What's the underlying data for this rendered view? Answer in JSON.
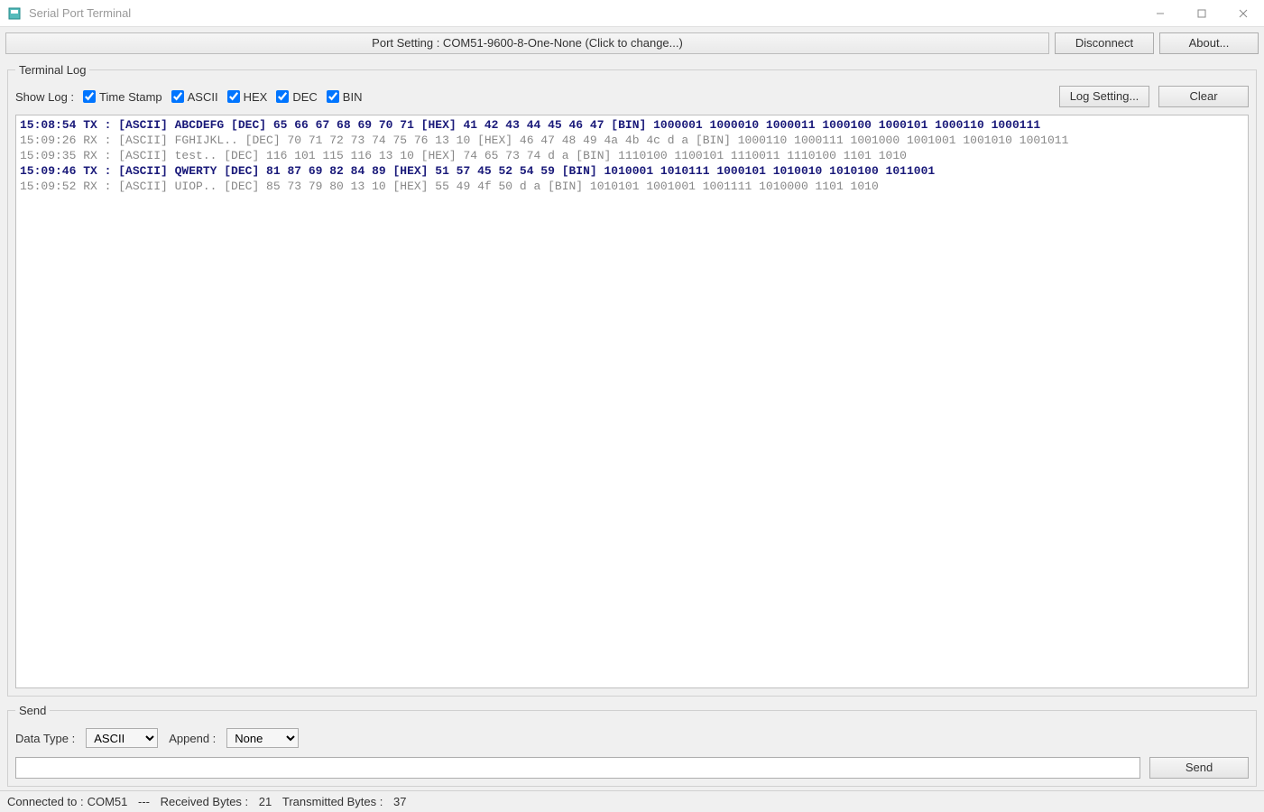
{
  "window": {
    "title": "Serial Port Terminal"
  },
  "toolbar": {
    "port_setting_label": "Port Setting : COM51-9600-8-One-None (Click to change...)",
    "disconnect_label": "Disconnect",
    "about_label": "About..."
  },
  "log_panel": {
    "legend": "Terminal Log",
    "show_log_label": "Show Log :",
    "checkboxes": {
      "timestamp": "Time Stamp",
      "ascii": "ASCII",
      "hex": "HEX",
      "dec": "DEC",
      "bin": "BIN"
    },
    "log_setting_label": "Log Setting...",
    "clear_label": "Clear",
    "lines": [
      {
        "cls": "tx",
        "text": "15:08:54 TX : [ASCII] ABCDEFG [DEC] 65 66 67 68 69 70 71 [HEX] 41 42 43 44 45 46 47 [BIN] 1000001 1000010 1000011 1000100 1000101 1000110 1000111"
      },
      {
        "cls": "rx",
        "text": "15:09:26 RX : [ASCII] FGHIJKL.. [DEC] 70 71 72 73 74 75 76 13 10 [HEX] 46 47 48 49 4a 4b 4c d a [BIN] 1000110 1000111 1001000 1001001 1001010 1001011"
      },
      {
        "cls": "rx",
        "text": "15:09:35 RX : [ASCII] test.. [DEC] 116 101 115 116 13 10 [HEX] 74 65 73 74 d a [BIN] 1110100 1100101 1110011 1110100 1101 1010"
      },
      {
        "cls": "tx",
        "text": "15:09:46 TX : [ASCII] QWERTY [DEC] 81 87 69 82 84 89 [HEX] 51 57 45 52 54 59 [BIN] 1010001 1010111 1000101 1010010 1010100 1011001"
      },
      {
        "cls": "rx",
        "text": "15:09:52 RX : [ASCII] UIOP.. [DEC] 85 73 79 80 13 10 [HEX] 55 49 4f 50 d a [BIN] 1010101 1001001 1001111 1010000 1101 1010"
      }
    ]
  },
  "send_panel": {
    "legend": "Send",
    "data_type_label": "Data Type :",
    "data_type_value": "ASCII",
    "append_label": "Append :",
    "append_value": "None",
    "send_button": "Send",
    "input_value": ""
  },
  "statusbar": {
    "connected_label": "Connected to :",
    "port": "COM51",
    "sep": "---",
    "rx_label": "Received Bytes :",
    "rx_value": "21",
    "tx_label": "Transmitted Bytes :",
    "tx_value": "37"
  }
}
